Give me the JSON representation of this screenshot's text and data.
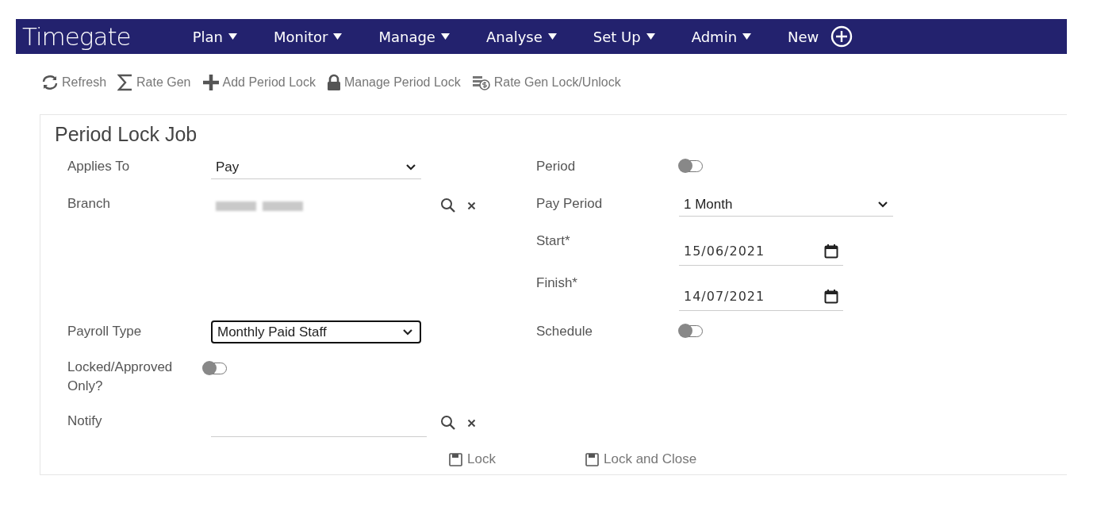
{
  "nav": {
    "logo": "Timegate",
    "menus": [
      {
        "label": "Plan",
        "dropdown": true
      },
      {
        "label": "Monitor",
        "dropdown": true
      },
      {
        "label": "Manage",
        "dropdown": true
      },
      {
        "label": "Analyse",
        "dropdown": true
      },
      {
        "label": "Set Up",
        "dropdown": true
      },
      {
        "label": "Admin",
        "dropdown": true
      },
      {
        "label": "New",
        "dropdown": false
      }
    ]
  },
  "toolbar": [
    {
      "label": "Refresh",
      "kind": "refresh"
    },
    {
      "label": "Rate Gen",
      "kind": "sigma"
    },
    {
      "label": "Add Period Lock",
      "kind": "add"
    },
    {
      "label": "Manage Period Lock",
      "kind": "lock"
    },
    {
      "label": "Rate Gen Lock/Unlock",
      "kind": "coins"
    }
  ],
  "form": {
    "title": "Period Lock Job",
    "left": [
      {
        "label": "Applies To",
        "kind": "select",
        "value": "Pay",
        "focused": false
      },
      {
        "label": "Branch",
        "kind": "lookup",
        "value_hidden": true
      },
      {
        "label": "Payroll Type",
        "kind": "select",
        "value": "Monthly Paid Staff",
        "focused": true
      },
      {
        "label": "Locked/Approved Only?",
        "kind": "toggle",
        "on": false
      },
      {
        "label": "Notify",
        "kind": "lookup",
        "value_hidden": false
      }
    ],
    "right": [
      {
        "label": "Period",
        "kind": "toggle",
        "on": false
      },
      {
        "label": "Pay Period",
        "kind": "select",
        "value": "1 Month",
        "focused": false
      },
      {
        "label": "Start*",
        "kind": "date",
        "value": "15/06/2021"
      },
      {
        "label": "Finish*",
        "kind": "date",
        "value": "14/07/2021"
      },
      {
        "label": "Schedule",
        "kind": "toggle",
        "on": false
      }
    ],
    "buttons": [
      "Lock",
      "Lock and Close"
    ]
  }
}
